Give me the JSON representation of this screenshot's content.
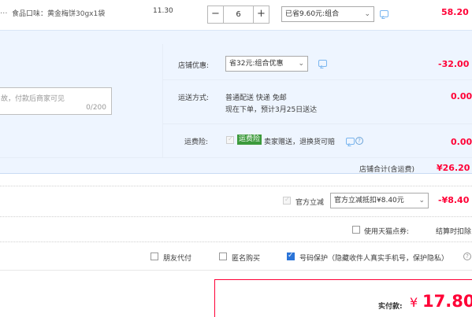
{
  "product": {
    "spec_label": "食品口味：黄金梅饼30gx1袋",
    "unit_price": "11.30",
    "quantity": "6",
    "minus_label": "−",
    "plus_label": "+",
    "promo_select": "已省9.60元:组合",
    "subtotal": "58.20"
  },
  "shop": {
    "discount_label": "店铺优惠:",
    "discount_select": "省32元:组合优惠",
    "discount_amount": "-32.00",
    "message_placeholder": "故，付款后商家可见",
    "message_counter": "0/200",
    "shipping_label": "运送方式:",
    "shipping_method": "普通配送 快递 免邮",
    "shipping_eta": "现在下单，预计3月25日送达",
    "shipping_amount": "0.00",
    "insurance_label": "运费险:",
    "insurance_badge": "运费险",
    "insurance_text": "卖家赠送，退换货可赔",
    "insurance_amount": "0.00",
    "total_label": "店铺合计(含运费)",
    "total_value": "¥26.20"
  },
  "official": {
    "label": "官方立减",
    "select": "官方立减抵扣¥8.40元",
    "amount": "-¥8.40"
  },
  "points": {
    "label": "使用天猫点券:",
    "note": "结算时扣除"
  },
  "options": {
    "friend_pay": "朋友代付",
    "anonymous": "匿名购买",
    "privacy": "号码保护（隐藏收件人真实手机号，保护隐私）"
  },
  "payment": {
    "label": "实付款:",
    "currency": "¥",
    "amount": "17.80"
  },
  "icons": {
    "chat": "chat-bubble-icon",
    "help": "question-circle-icon",
    "dropdown": "chevron-down-icon"
  },
  "colors": {
    "accent_red": "#ff0036",
    "panel_blue": "#eef5ff",
    "badge_green": "#3c9a3c",
    "checkbox_blue": "#2b74d8"
  }
}
